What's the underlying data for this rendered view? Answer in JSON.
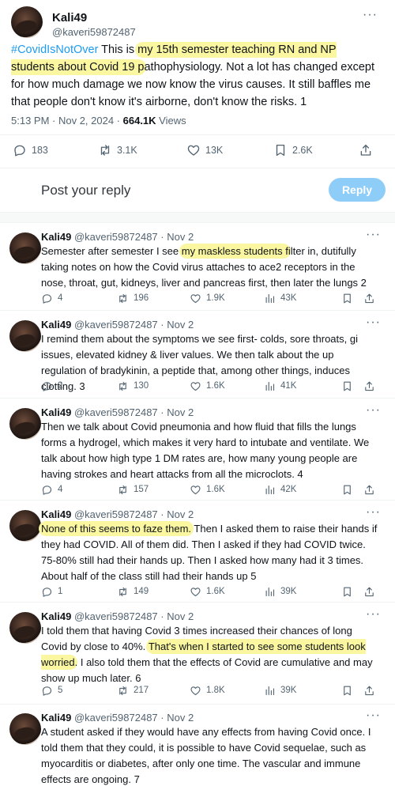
{
  "main": {
    "name": "Kali49",
    "handle": "@kaveri59872487",
    "hashtag": "#CovidIsNotOver",
    "text_a": " This is ",
    "text_hl": "my 15th semester teaching RN and NP students about Covid 19 p",
    "text_b": "athophysiology.  Not a lot has changed except for how much damage we now know the virus causes.  It still baffles me that people don't know it's airborne, don't know the risks.  1",
    "time": "5:13 PM · Nov 2, 2024 · ",
    "views_count": "664.1K",
    "views_label": " Views",
    "replies": "183",
    "reposts": "3.1K",
    "likes": "13K",
    "bookmarks": "2.6K"
  },
  "reply_box": {
    "placeholder": "Post your reply",
    "button": "Reply"
  },
  "replies": [
    {
      "name": "Kali49",
      "handle": "@kaveri59872487",
      "date": " · Nov 2",
      "a": "Semester after semester I see ",
      "hl": "my maskless students f",
      "b": "ilter in, dutifully taking notes on how the Covid virus attaches to ace2 receptors in the nose, throat, gut, kidneys, liver and pancreas first, then later the lungs 2",
      "c": "",
      "d": "",
      "replies": "4",
      "reposts": "196",
      "likes": "1.9K",
      "views": "43K"
    },
    {
      "name": "Kali49",
      "handle": "@kaveri59872487",
      "date": " · Nov 2",
      "a": "I remind them about the symptoms we see first- colds, sore throats, gi issues, elevated kidney & liver values.  We then talk about the up regulation of bradykinin, a peptide that, among other things, induces clotting. 3",
      "hl": "",
      "b": "",
      "c": "",
      "d": "",
      "replies": "2",
      "reposts": "130",
      "likes": "1.6K",
      "views": "41K"
    },
    {
      "name": "Kali49",
      "handle": "@kaveri59872487",
      "date": " · Nov 2",
      "a": "Then we talk about Covid pneumonia and how fluid that fills the lungs forms a hydrogel, which makes it very hard to intubate and ventilate.  We talk about how high type 1 DM rates are, how many young people are having strokes and heart attacks from all the microclots.  4",
      "hl": "",
      "b": "",
      "c": "",
      "d": "",
      "replies": "4",
      "reposts": "157",
      "likes": "1.6K",
      "views": "42K"
    },
    {
      "name": "Kali49",
      "handle": "@kaveri59872487",
      "date": " · Nov 2",
      "a": "",
      "hl": "None of this seems to faze them.",
      "b": "  Then I asked them to raise their hands if they had COVID. All of them did.  Then I asked if they had COVID twice.  75-80% still had their hands up. Then I asked how many had it 3 times.  About half of the class still had their hands up 5",
      "c": "",
      "d": "",
      "replies": "1",
      "reposts": "149",
      "likes": "1.6K",
      "views": "39K"
    },
    {
      "name": "Kali49",
      "handle": "@kaveri59872487",
      "date": " · Nov 2",
      "a": "I told them that having Covid 3 times increased their chances of long Covid by close to 40%. ",
      "hl": "That's when I started to see some students look worried",
      "b": ".  I also told them that the effects of Covid are cumulative and may show up much later.  6",
      "c": "",
      "d": "",
      "replies": "5",
      "reposts": "217",
      "likes": "1.8K",
      "views": "39K"
    },
    {
      "name": "Kali49",
      "handle": "@kaveri59872487",
      "date": " · Nov 2",
      "a": "A student asked if they would have any effects from having Covid once.  I told them that they could, it is possible to have Covid sequelae, such as myocarditis or diabetes, after only one time.  The vascular and immune effects are ongoing.  7",
      "hl": "",
      "b": "",
      "c": "",
      "d": "",
      "replies": "",
      "reposts": "",
      "likes": "",
      "views": ""
    }
  ]
}
